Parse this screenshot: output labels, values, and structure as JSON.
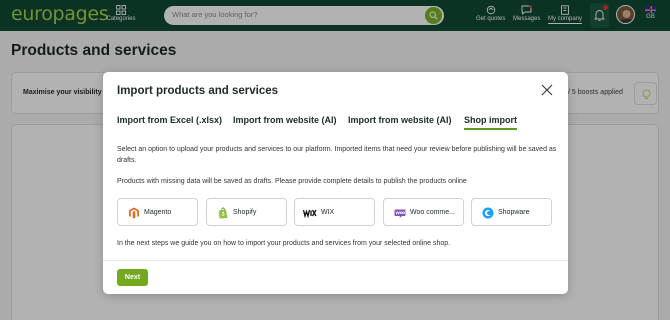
{
  "header": {
    "logo": "europages",
    "categories_label": "Categories",
    "search_placeholder": "What are you looking for?",
    "nav": [
      {
        "label": "Get quotes"
      },
      {
        "label": "Messages"
      },
      {
        "label": "My company"
      }
    ],
    "lang": "GB"
  },
  "page": {
    "title": "Products and services",
    "boost_text": "Maximise your visibility",
    "boost_status": "/ 5 boosts applied"
  },
  "modal": {
    "title": "Import products and services",
    "tabs": [
      {
        "label": "Import from Excel (.xlsx)"
      },
      {
        "label": "Import from website (AI)"
      },
      {
        "label": "Import from website (AI)"
      },
      {
        "label": "Shop import",
        "active": true
      }
    ],
    "description": "Select an option to upload your products and services to our platform. Imported items that need your review before publishing will be saved as drafts.",
    "drafts_note": "Products with missing data will be saved as drafts. Please provide complete details to publish the products online",
    "shops": [
      {
        "label": "Magento",
        "icon": "magento-icon"
      },
      {
        "label": "Shopify",
        "icon": "shopify-icon"
      },
      {
        "label": "WIX",
        "icon": "wix-icon"
      },
      {
        "label": "Woo comme...",
        "icon": "woocommerce-icon"
      },
      {
        "label": "Shopware",
        "icon": "shopware-icon"
      }
    ],
    "guide_text": "In the next steps we guide you on how to import your products and services from your selected online shop.",
    "next_label": "Next"
  },
  "colors": {
    "header_bg": "#0f4a34",
    "accent_green": "#74a81f"
  }
}
